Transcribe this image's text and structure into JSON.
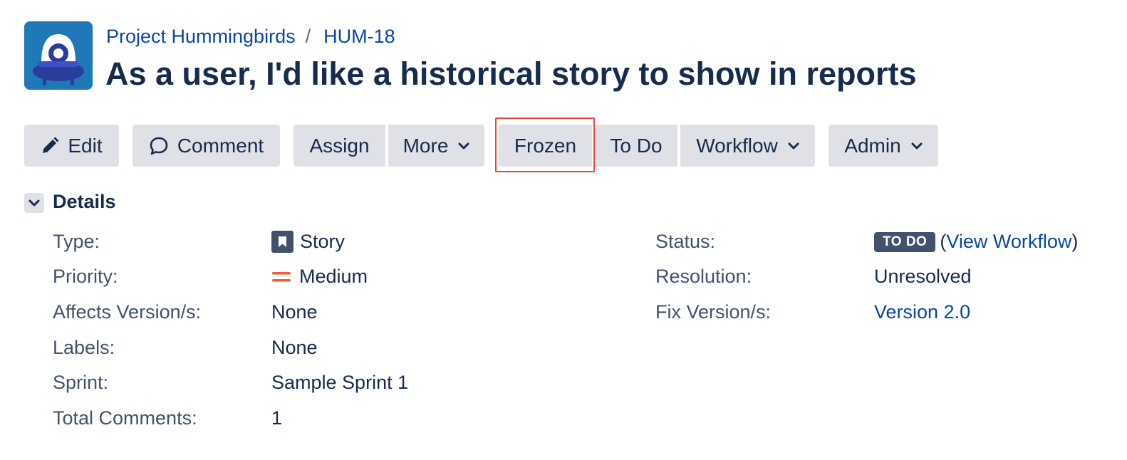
{
  "breadcrumb": {
    "project": "Project Hummingbirds",
    "separator": "/",
    "issue_key": "HUM-18"
  },
  "issue": {
    "title": "As a user, I'd like a historical story to show in reports"
  },
  "toolbar": {
    "edit": "Edit",
    "comment": "Comment",
    "assign": "Assign",
    "more": "More",
    "frozen": "Frozen",
    "to_do": "To Do",
    "workflow": "Workflow",
    "admin": "Admin"
  },
  "details": {
    "heading": "Details",
    "left": [
      {
        "label": "Type:",
        "value": "Story",
        "icon": "story-icon"
      },
      {
        "label": "Priority:",
        "value": "Medium",
        "icon": "priority-medium-icon"
      },
      {
        "label": "Affects Version/s:",
        "value": "None"
      },
      {
        "label": "Labels:",
        "value": "None"
      },
      {
        "label": "Sprint:",
        "value": "Sample Sprint 1"
      },
      {
        "label": "Total Comments:",
        "value": "1"
      }
    ],
    "right": {
      "status_label": "Status:",
      "status_value": "TO DO",
      "view_workflow_open": "(",
      "view_workflow": "View Workflow",
      "view_workflow_close": ")",
      "resolution_label": "Resolution:",
      "resolution_value": "Unresolved",
      "fix_version_label": "Fix Version/s:",
      "fix_version_value": "Version 2.0"
    }
  },
  "colors": {
    "link": "#0747a6",
    "button_bg": "#dfe1e6",
    "highlight": "#e5483b",
    "status_bg": "#42526e",
    "priority": "#ff5630",
    "avatar_bg": "#1f78b8"
  }
}
